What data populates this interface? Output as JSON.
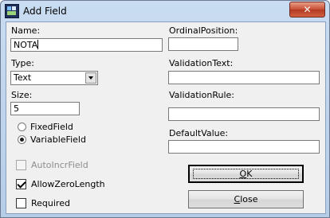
{
  "window": {
    "title": "Add Field",
    "close_glyph": "✕"
  },
  "left": {
    "name": {
      "label": "Name:",
      "value": "NOTA"
    },
    "type": {
      "label": "Type:",
      "selected": "Text"
    },
    "size": {
      "label": "Size:",
      "value": "5"
    },
    "radios": [
      {
        "label": "FixedField",
        "checked": false
      },
      {
        "label": "VariableField",
        "checked": true
      }
    ],
    "checkboxes": [
      {
        "label": "AutoIncrField",
        "checked": false,
        "enabled": false
      },
      {
        "label": "AllowZeroLength",
        "checked": true,
        "enabled": true
      },
      {
        "label": "Required",
        "checked": false,
        "enabled": true
      }
    ]
  },
  "right": {
    "ordinal": {
      "label": "OrdinalPosition:",
      "value": ""
    },
    "validation_text": {
      "label": "ValidationText:",
      "value": ""
    },
    "validation_rule": {
      "label": "ValidationRule:",
      "value": ""
    },
    "default_value": {
      "label": "DefaultValue:",
      "value": ""
    }
  },
  "buttons": {
    "ok": {
      "label_hot": "O",
      "label_rest": "K"
    },
    "close": {
      "label_hot": "C",
      "label_rest": "lose"
    }
  },
  "colors": {
    "title_bar": "#c9dcf1",
    "close_button": "#c64d33",
    "dialog_bg": "#f0f0f0"
  }
}
